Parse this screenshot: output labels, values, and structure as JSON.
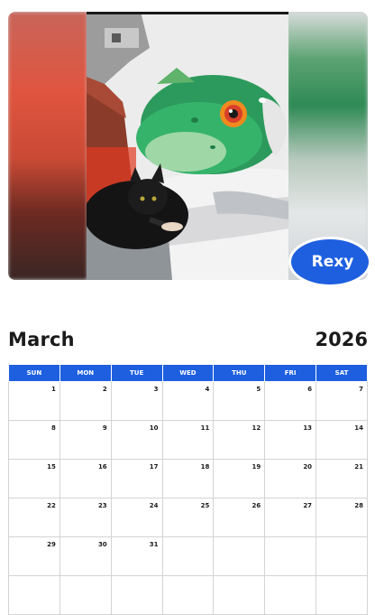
{
  "pet_name": "Rexy",
  "month": "March",
  "year": "2026",
  "colors": {
    "accent": "#1e5fe0",
    "text": "#1b1b1b",
    "grid": "#d4d4d4"
  },
  "weekdays": [
    "SUN",
    "MON",
    "TUE",
    "WED",
    "THU",
    "FRI",
    "SAT"
  ],
  "weeks": [
    [
      "1",
      "2",
      "3",
      "4",
      "5",
      "6",
      "7"
    ],
    [
      "8",
      "9",
      "10",
      "11",
      "12",
      "13",
      "14"
    ],
    [
      "15",
      "16",
      "17",
      "18",
      "19",
      "20",
      "21"
    ],
    [
      "22",
      "23",
      "24",
      "25",
      "26",
      "27",
      "28"
    ],
    [
      "29",
      "30",
      "31",
      "",
      "",
      "",
      ""
    ],
    [
      "",
      "",
      "",
      "",
      "",
      "",
      ""
    ]
  ]
}
